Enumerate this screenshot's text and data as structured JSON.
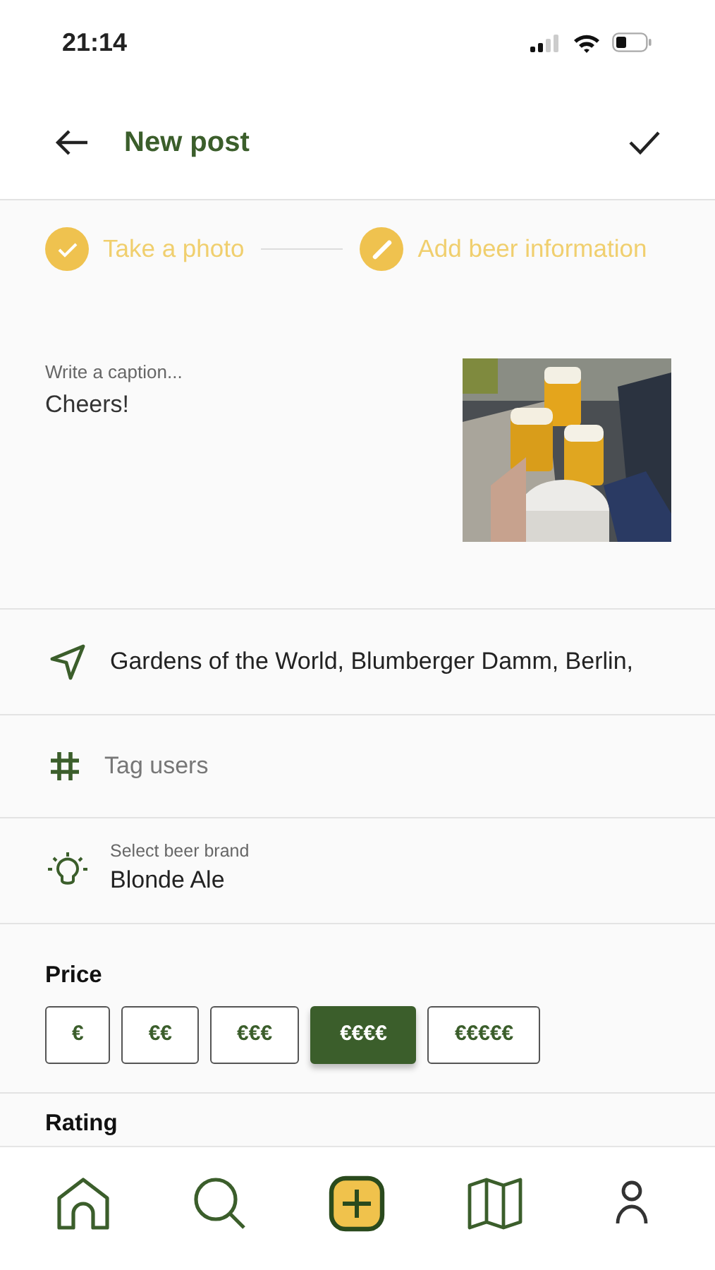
{
  "status_bar": {
    "time": "21:14"
  },
  "header": {
    "title": "New post"
  },
  "steps": [
    {
      "label": "Take a photo",
      "kind": "done"
    },
    {
      "label": "Add beer information",
      "kind": "edit"
    }
  ],
  "caption": {
    "label": "Write a caption...",
    "value": "Cheers!"
  },
  "fields": [
    {
      "kind": "location",
      "value": "Gardens of the World, Blumberger Damm, Berlin,"
    },
    {
      "kind": "tags",
      "placeholder": "Tag users"
    },
    {
      "kind": "brand",
      "label": "Select beer brand",
      "value": "Blonde Ale"
    }
  ],
  "price": {
    "title": "Price",
    "options": [
      {
        "label": "€",
        "selected": false
      },
      {
        "label": "€€",
        "selected": false
      },
      {
        "label": "€€€",
        "selected": false
      },
      {
        "label": "€€€€",
        "selected": true
      },
      {
        "label": "€€€€€",
        "selected": false
      }
    ]
  },
  "rating": {
    "title": "Rating"
  },
  "nav": [
    {
      "kind": "home",
      "selected": false
    },
    {
      "kind": "search",
      "selected": false
    },
    {
      "kind": "add",
      "selected": true
    },
    {
      "kind": "map",
      "selected": false
    },
    {
      "kind": "profile",
      "selected": false
    }
  ]
}
